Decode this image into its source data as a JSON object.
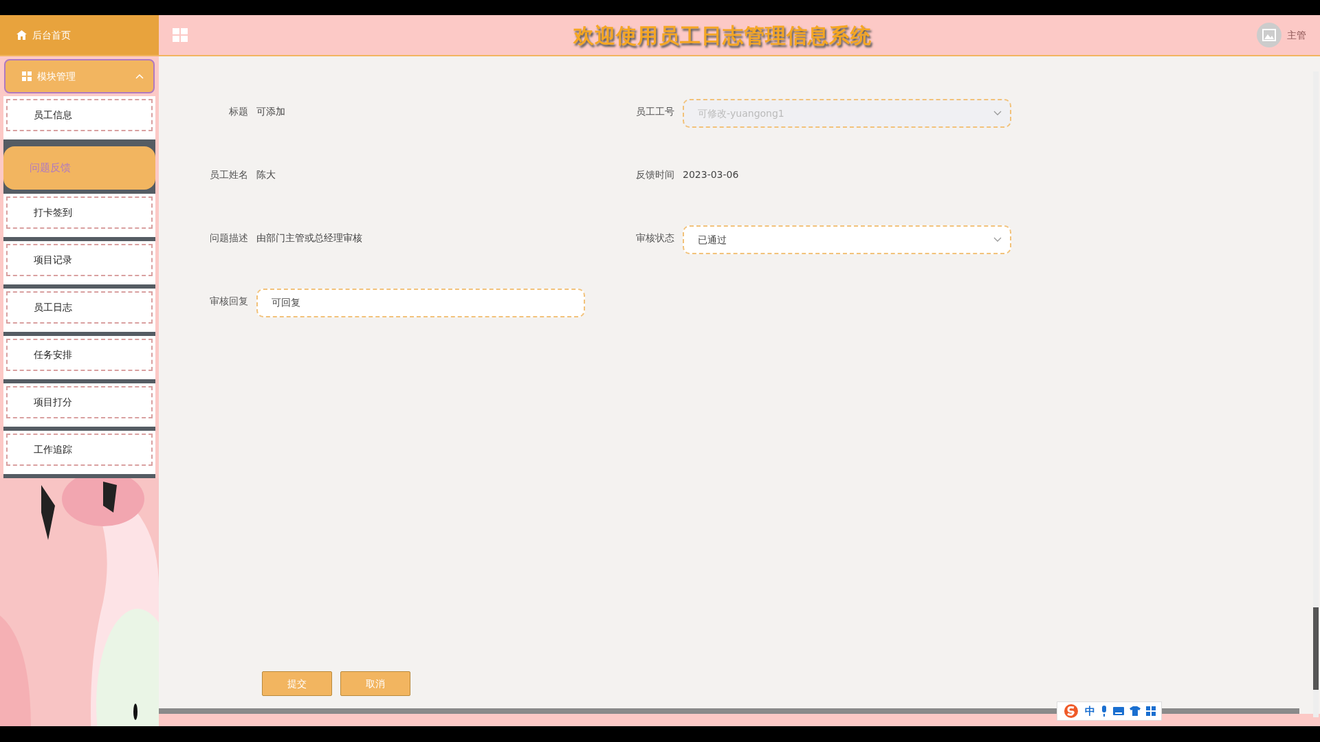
{
  "header": {
    "home_label": "后台首页",
    "title": "欢迎使用员工日志管理信息系统",
    "user": "主管"
  },
  "sidebar": {
    "group": {
      "label": "模块管理",
      "expanded": true
    },
    "items": [
      {
        "label": "员工信息",
        "selected": false
      },
      {
        "label": "问题反馈",
        "selected": true
      },
      {
        "label": "打卡签到",
        "selected": false
      },
      {
        "label": "项目记录",
        "selected": false
      },
      {
        "label": "员工日志",
        "selected": false
      },
      {
        "label": "任务安排",
        "selected": false
      },
      {
        "label": "项目打分",
        "selected": false
      },
      {
        "label": "工作追踪",
        "selected": false
      }
    ]
  },
  "form": {
    "fields": [
      {
        "kind": "text",
        "label": "标题",
        "value": "可添加"
      },
      {
        "kind": "select",
        "label": "员工工号",
        "placeholder": "可修改-yuangong1",
        "disabled": true
      },
      {
        "kind": "text",
        "label": "员工姓名",
        "value": "陈大"
      },
      {
        "kind": "text",
        "label": "反馈时间",
        "value": "2023-03-06"
      },
      {
        "kind": "text",
        "label": "问题描述",
        "value": "由部门主管或总经理审核"
      },
      {
        "kind": "select",
        "label": "审核状态",
        "value": "已通过",
        "disabled": false
      },
      {
        "kind": "input",
        "label": "审核回复",
        "value": "可回复"
      }
    ],
    "buttons": [
      {
        "label": "提交"
      },
      {
        "label": "取消"
      }
    ]
  },
  "ime": {
    "mode": "中"
  }
}
